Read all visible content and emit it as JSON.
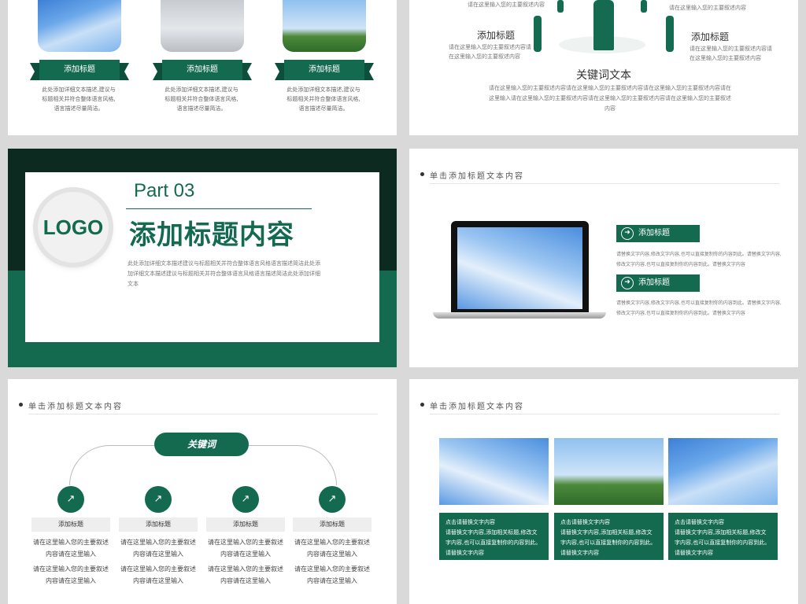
{
  "slide1": {
    "captions": [
      {
        "title": "添加标题",
        "text": "此处添加详细文本描述,建议与标题相关并符合整体语言风格,语言描述尽量简洁。"
      },
      {
        "title": "添加标题",
        "text": "此处添加详细文本描述,建议与标题相关并符合整体语言风格,语言描述尽量简洁。"
      },
      {
        "title": "添加标题",
        "text": "此处添加详细文本描述,建议与标题相关并符合整体语言风格,语言描述尽量简洁。"
      }
    ]
  },
  "slide2": {
    "top_text": "请在这里输入您的主要叙述内容",
    "top_text_right": "请在这里输入您的主要叙述内容",
    "left_title": "添加标题",
    "left_text": "请在这里输入您的主要叙述内容请在这里输入您的主要叙述内容",
    "right_title": "添加标题",
    "right_text": "请在这里输入您的主要叙述内容请在这里输入您的主要叙述内容",
    "keyword": "关键词文本",
    "keyword_text": "请在这里输入您的主要叙述内容请在这里输入您的主要叙述内容请在这里输入您的主要叙述内容请在这里输入请在这里输入您的主要叙述内容请在这里输入您的主要叙述内容请在这里输入您的主要叙述内容"
  },
  "slide3": {
    "logo": "LOGO",
    "part": "Part 03",
    "title": "添加标题内容",
    "subtitle": "此处添加详细文本描述建议与标题相关并符合整体语言风格语言描述简洁此处添加详细文本描述建议与标题相关并符合整体语言风格语言描述简洁此处添加详细文本"
  },
  "slide4": {
    "header": "单击添加标题文本内容",
    "items": [
      {
        "label": "添加标题",
        "text": "请替换文字内容,修改文字内容,也可以直接复制你的内容到此。请替换文字内容,修改文字内容,也可以直接复制你的内容到此。请替换文字内容"
      },
      {
        "label": "添加标题",
        "text": "请替换文字内容,修改文字内容,也可以直接复制你的内容到此。请替换文字内容,修改文字内容,也可以直接复制你的内容到此。请替换文字内容"
      }
    ]
  },
  "slide5": {
    "header": "单击添加标题文本内容",
    "keyword": "关键词",
    "columns": [
      {
        "label": "添加标题",
        "text1": "请在这里输入您的主要叙述内容请在这里输入",
        "text2": "请在这里输入您的主要叙述内容请在这里输入"
      },
      {
        "label": "添加标题",
        "text1": "请在这里输入您的主要叙述内容请在这里输入",
        "text2": "请在这里输入您的主要叙述内容请在这里输入"
      },
      {
        "label": "添加标题",
        "text1": "请在这里输入您的主要叙述内容请在这里输入",
        "text2": "请在这里输入您的主要叙述内容请在这里输入"
      },
      {
        "label": "添加标题",
        "text1": "请在这里输入您的主要叙述内容请在这里输入",
        "text2": "请在这里输入您的主要叙述内容请在这里输入"
      }
    ]
  },
  "slide6": {
    "header": "单击添加标题文本内容",
    "boxes": [
      {
        "title": "点击请替换文字内容",
        "text": "请替换文字内容,添加相关标题,修改文字内容,也可以直接复制你的内容到此。请替换文字内容"
      },
      {
        "title": "点击请替换文字内容",
        "text": "请替换文字内容,添加相关标题,修改文字内容,也可以直接复制你的内容到此。请替换文字内容"
      },
      {
        "title": "点击请替换文字内容",
        "text": "请替换文字内容,添加相关标题,修改文字内容,也可以直接复制你的内容到此。请替换文字内容"
      }
    ]
  },
  "colors": {
    "brand_green": "#146a4f",
    "dark_green": "#0d2a20",
    "background": "#d9d9d9"
  }
}
